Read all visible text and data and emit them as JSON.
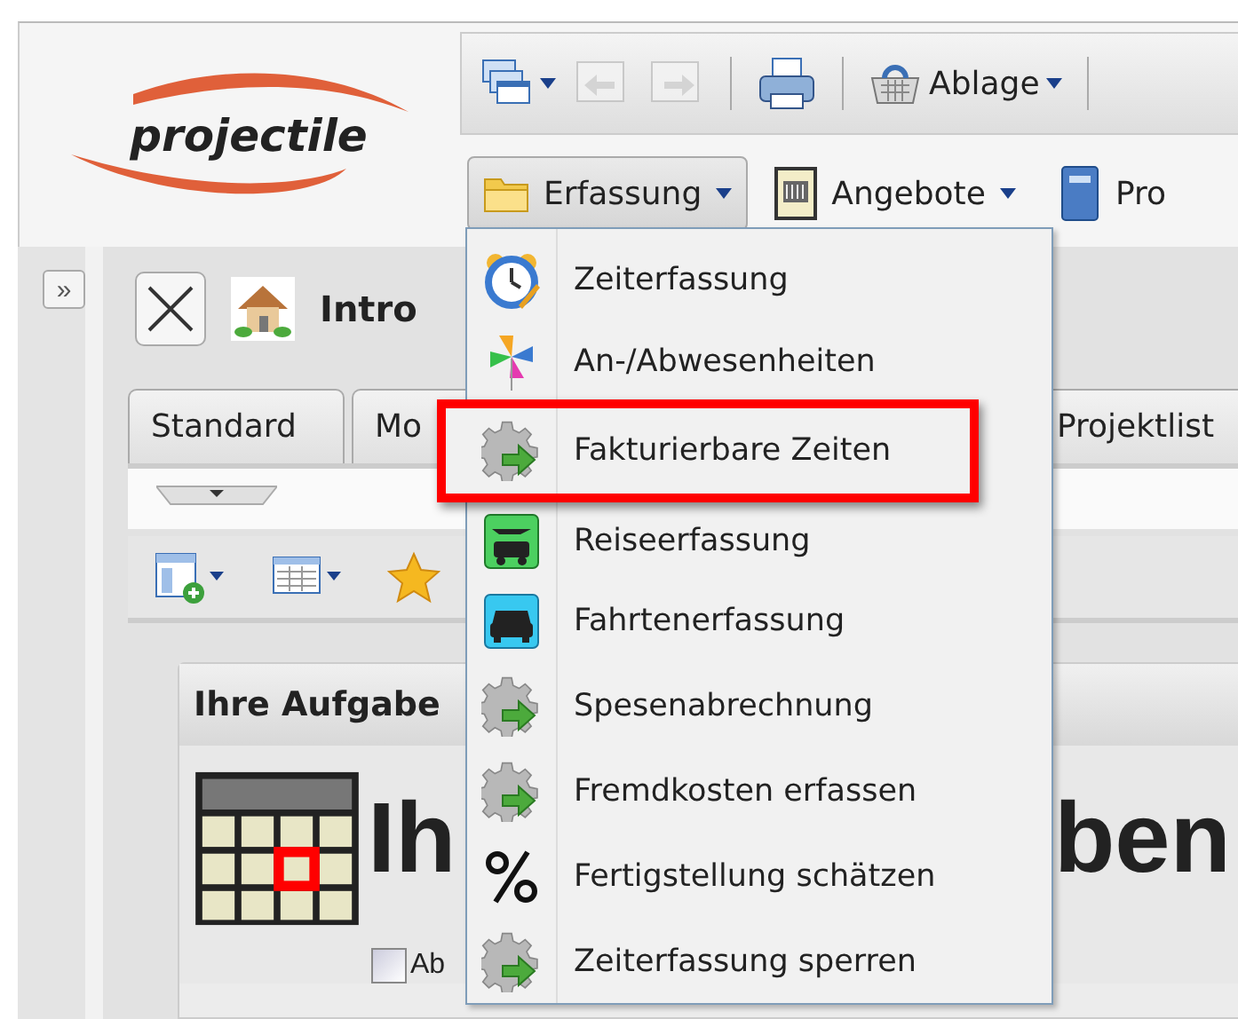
{
  "logo": "projectile",
  "toolbar": [
    {
      "kind": "windows"
    },
    {
      "kind": "back",
      "disabled": true
    },
    {
      "kind": "forward",
      "disabled": true
    },
    {
      "kind": "separator"
    },
    {
      "kind": "print"
    },
    {
      "kind": "separator"
    },
    {
      "kind": "basket",
      "label": "Ablage"
    },
    {
      "kind": "separator"
    }
  ],
  "menubar": [
    {
      "kind": "folder",
      "label": "Erfassung",
      "selected": true
    },
    {
      "kind": "document",
      "label": "Angebote",
      "selected": false
    },
    {
      "kind": "book",
      "label": "Pro",
      "selected": false
    }
  ],
  "sidebar_toggle": "»",
  "tab_header": {
    "title": "Intro"
  },
  "tabs": [
    {
      "label": "Standard",
      "selected": false
    },
    {
      "label": "Mo",
      "selected": false
    },
    {
      "label": "Projektlist",
      "selected": false
    }
  ],
  "panel": {
    "title": "Ihre Aufgabe",
    "heading_left": "Ih",
    "heading_right": "ben",
    "checkbox": {
      "label": "Ab",
      "checked": false
    }
  },
  "menu": [
    {
      "kind": "clock",
      "label": "Zeiterfassung",
      "highlighted": false
    },
    {
      "kind": "pinwheel",
      "label": "An-/Abwesenheiten",
      "highlighted": false
    },
    {
      "kind": "gear",
      "label": "Fakturierbare Zeiten",
      "highlighted": true
    },
    {
      "kind": "travel",
      "label": "Reiseerfassung",
      "highlighted": false
    },
    {
      "kind": "car",
      "label": "Fahrtenerfassung",
      "highlighted": false
    },
    {
      "kind": "gear",
      "label": "Spesenabrechnung",
      "highlighted": false
    },
    {
      "kind": "gear",
      "label": "Fremdkosten erfassen",
      "highlighted": false
    },
    {
      "kind": "percent",
      "label": "Fertigstellung schätzen",
      "highlighted": false
    },
    {
      "kind": "gear",
      "label": "Zeiterfassung sperren",
      "highlighted": false
    }
  ]
}
